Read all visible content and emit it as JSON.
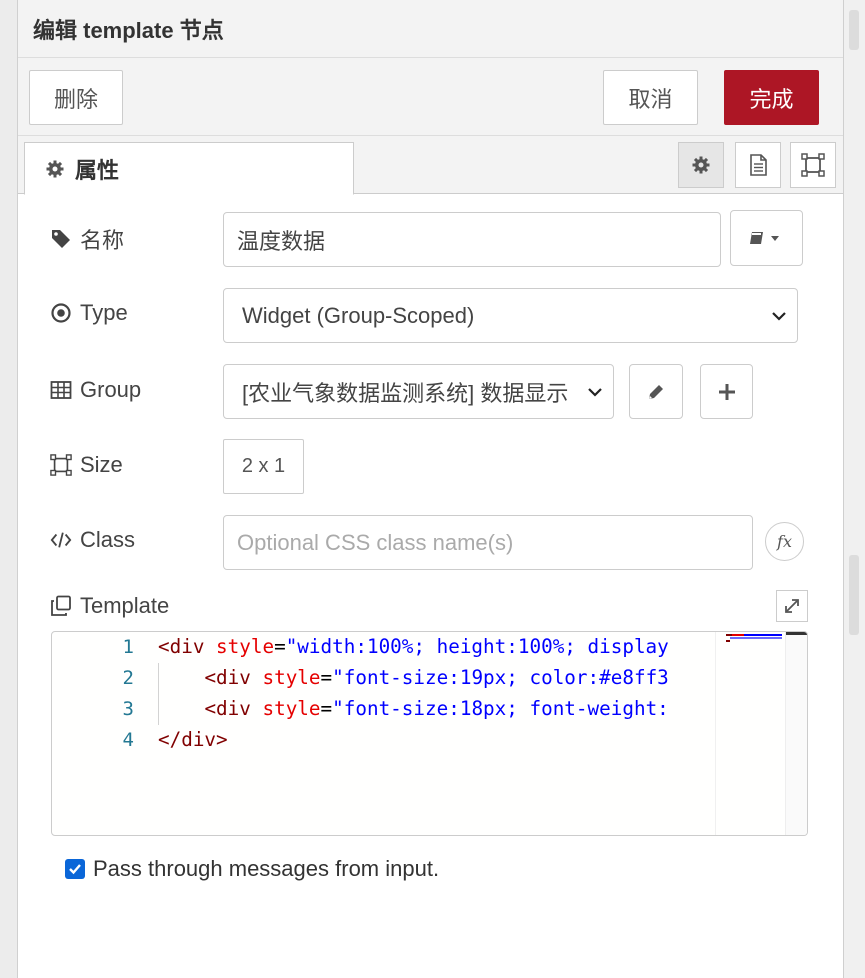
{
  "header": {
    "title": "编辑 template 节点"
  },
  "toolbar": {
    "delete_label": "删除",
    "cancel_label": "取消",
    "done_label": "完成"
  },
  "tabs": [
    {
      "label": "属性",
      "icon": "gear-icon"
    }
  ],
  "tab_tools": [
    "gear-icon",
    "document-icon",
    "size-frame-icon"
  ],
  "form": {
    "name": {
      "label": "名称",
      "value": "温度数据",
      "icon": "tag-icon"
    },
    "type": {
      "label": "Type",
      "value": "Widget (Group-Scoped)",
      "icon": "dot-circle-icon"
    },
    "group": {
      "label": "Group",
      "value": "[农业气象数据监测系统] 数据显示",
      "icon": "table-icon"
    },
    "size": {
      "label": "Size",
      "value": "2 x 1",
      "icon": "size-frame-icon"
    },
    "class": {
      "label": "Class",
      "placeholder": "Optional CSS class name(s)",
      "icon": "code-icon"
    },
    "template": {
      "label": "Template",
      "icon": "clone-icon",
      "line_numbers": [
        "1",
        "2",
        "3",
        "4"
      ],
      "lines": [
        {
          "indent": "",
          "tag": "<div",
          "attr": " style",
          "eq": "=",
          "str": "\"width:100%; height:100%; display"
        },
        {
          "indent": "    ",
          "tag": "<div",
          "attr": " style",
          "eq": "=",
          "str": "\"font-size:19px; color:#e8ff3"
        },
        {
          "indent": "    ",
          "tag": "<div",
          "attr": " style",
          "eq": "=",
          "str": "\"font-size:18px; font-weight:"
        },
        {
          "indent": "",
          "tag": "</div>",
          "attr": "",
          "eq": "",
          "str": ""
        }
      ]
    },
    "passthru": {
      "label": "Pass through messages from input.",
      "checked": true
    }
  },
  "colors": {
    "primary": "#ad1625",
    "checkbox": "#0a66d8",
    "line_number": "#237893"
  }
}
